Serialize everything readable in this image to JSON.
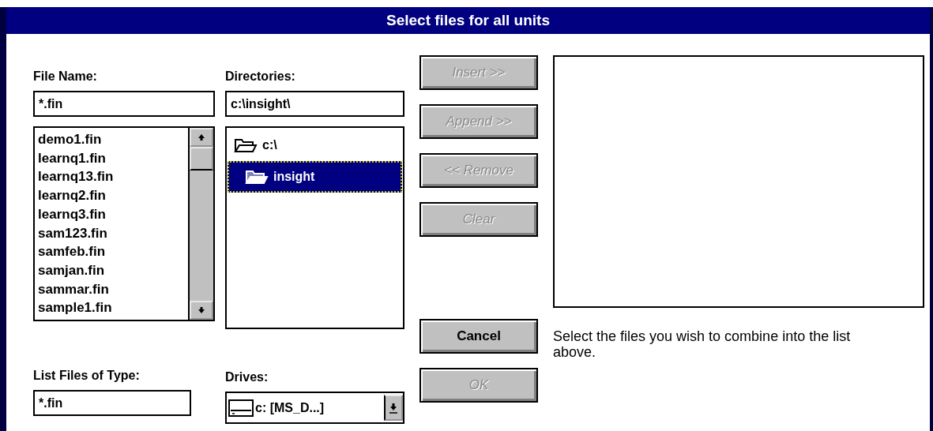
{
  "window": {
    "title": "Select files for all units"
  },
  "file_name": {
    "label": "File Name:",
    "value": "*.fin",
    "files": [
      {
        "name": "demo1.fin",
        "selected": false
      },
      {
        "name": "learnq1.fin",
        "selected": false
      },
      {
        "name": "learnq13.fin",
        "selected": false
      },
      {
        "name": "learnq2.fin",
        "selected": false
      },
      {
        "name": "learnq3.fin",
        "selected": false
      },
      {
        "name": "sam123.fin",
        "selected": false
      },
      {
        "name": "samfeb.fin",
        "selected": false
      },
      {
        "name": "samjan.fin",
        "selected": false
      },
      {
        "name": "sammar.fin",
        "selected": false
      },
      {
        "name": "sample1.fin",
        "selected": false
      }
    ]
  },
  "directories": {
    "label": "Directories:",
    "value": "c:\\insight\\",
    "tree": [
      {
        "name": "c:\\",
        "selected": false,
        "children": [
          {
            "name": "insight",
            "selected": true
          }
        ]
      }
    ]
  },
  "list_buttons": [
    {
      "label": "Insert >>",
      "disabled": true
    },
    {
      "label": "Append >>",
      "disabled": true
    },
    {
      "label": "<< Remove",
      "disabled": true
    },
    {
      "label": "Clear",
      "disabled": true
    }
  ],
  "dialog_buttons": [
    {
      "label": "Cancel",
      "disabled": false
    },
    {
      "label": "OK",
      "disabled": true
    }
  ],
  "hint": "Select the files you wish to combine into the list above.",
  "file_type": {
    "label": "List Files of Type:",
    "value": "*.fin"
  },
  "drives": {
    "label": "Drives:",
    "value": "c: [MS_D...]"
  }
}
